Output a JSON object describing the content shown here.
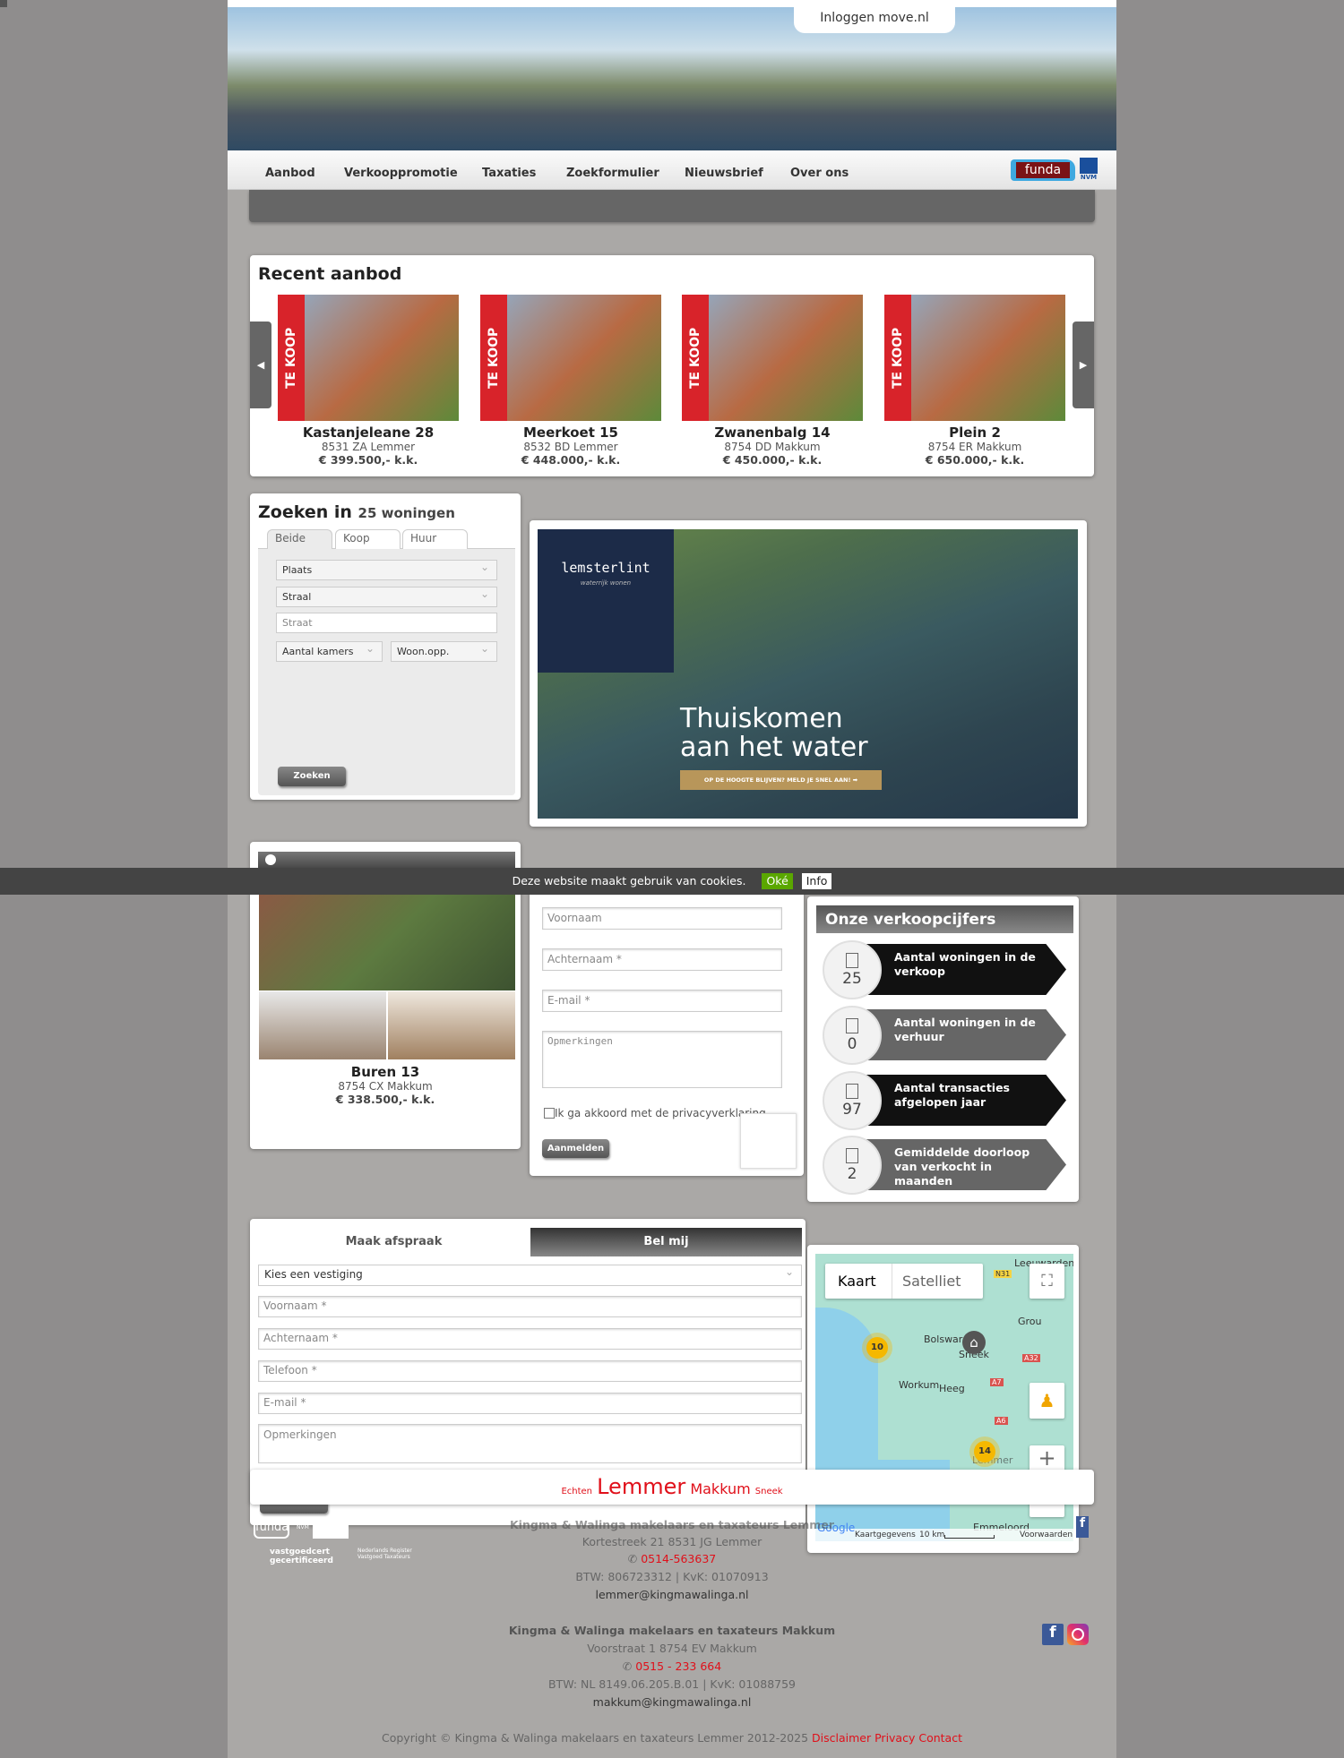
{
  "header": {
    "login_label": "Inloggen move.nl"
  },
  "nav": {
    "items": [
      "Aanbod",
      "Verkooppromotie",
      "Taxaties",
      "Zoekformulier",
      "Nieuwsbrief",
      "Over ons"
    ],
    "funda_logo": "funda",
    "nvm_logo": "NVM"
  },
  "recent": {
    "title": "Recent aanbod",
    "badge": "TE KOOP",
    "prev_icon": "chevron-left-icon",
    "next_icon": "chevron-right-icon",
    "items": [
      {
        "title": "Kastanjeleane 28",
        "address": "8531 ZA Lemmer",
        "price": "€ 399.500,- k.k."
      },
      {
        "title": "Meerkoet 15",
        "address": "8532 BD Lemmer",
        "price": "€ 448.000,- k.k."
      },
      {
        "title": "Zwanenbalg 14",
        "address": "8754 DD Makkum",
        "price": "€ 450.000,- k.k."
      },
      {
        "title": "Plein 2",
        "address": "8754 ER Makkum",
        "price": "€ 650.000,- k.k."
      }
    ]
  },
  "search": {
    "title": "Zoeken in",
    "count": "25 woningen",
    "tabs": [
      "Beide",
      "Koop",
      "Huur"
    ],
    "active_tab": "Beide",
    "plaats": "Plaats",
    "straal": "Straal",
    "straat_placeholder": "Straat",
    "kamers": "Aantal kamers",
    "woonopp": "Woon.opp.",
    "submit": "Zoeken"
  },
  "banner": {
    "brand": "lemsterlint",
    "tagline": "waterrijk wonen",
    "headline1": "Thuiskomen",
    "headline2": "aan het water",
    "cta": "OP DE HOOGTE BLIJVEN? MELD JE SNEL AAN!"
  },
  "featured": {
    "title": "Buren 13",
    "address": "8754 CX Makkum",
    "price": "€ 338.500,- k.k."
  },
  "cookie": {
    "text": "Deze website maakt gebruik van cookies.",
    "ok": "Oké",
    "info": "Info"
  },
  "newsletter": {
    "voornaam": "Voornaam",
    "achternaam": "Achternaam *",
    "email": "E-mail *",
    "opmerkingen": "Opmerkingen",
    "privacy": "Ik ga akkoord met de privacyverklaring",
    "submit": "Aanmelden"
  },
  "stats": {
    "title": "Onze verkoopcijfers",
    "items": [
      {
        "value": "25",
        "label": "Aantal woningen in de verkoop"
      },
      {
        "value": "0",
        "label": "Aantal woningen in de verhuur"
      },
      {
        "value": "97",
        "label": "Aantal transacties afgelopen jaar"
      },
      {
        "value": "2",
        "label": "Gemiddelde doorloop van verkocht in maanden"
      }
    ]
  },
  "appointment": {
    "tabs": [
      "Maak afspraak",
      "Bel mij"
    ],
    "vestiging": "Kies een vestiging",
    "voornaam": "Voornaam *",
    "achternaam": "Achternaam *",
    "telefoon": "Telefoon *",
    "email": "E-mail *",
    "opmerkingen": "Opmerkingen"
  },
  "map": {
    "type_map": "Kaart",
    "type_sat": "Satelliet",
    "clusters": [
      "10",
      "14"
    ],
    "labels": [
      "Leeuwarden",
      "Bolsward",
      "Sneek",
      "Grou",
      "Workum",
      "Heeg",
      "Emmeloord",
      "Lemmer"
    ],
    "roads": [
      "N31",
      "A32",
      "A7",
      "A6"
    ],
    "attribution": "Kaartgegevens",
    "scale": "10 km",
    "terms": "Voorwaarden",
    "google": "Google"
  },
  "cities": {
    "items": [
      "Echten",
      "Lemmer",
      "Makkum",
      "Sneek"
    ],
    "color": "#e0101a"
  },
  "footer": {
    "lemmer": {
      "name": "Kingma & Walinga makelaars en taxateurs Lemmer",
      "street": "Kortestreek 21   8531 JG Lemmer",
      "phone": "0514-563637",
      "btw": "BTW: 806723312 | KvK: 01070913",
      "email": "lemmer@kingmawalinga.nl"
    },
    "makkum": {
      "name": "Kingma & Walinga makelaars en taxateurs Makkum",
      "street": "Voorstraat 1   8754 EV Makkum",
      "phone": "0515 - 233 664",
      "btw": "BTW: NL 8149.06.205.B.01 | KvK: 01088759",
      "email": "makkum@kingmawalinga.nl"
    },
    "copyright": "Copyright © Kingma & Walinga makelaars en taxateurs Lemmer 2012-2025",
    "links": [
      "Disclaimer",
      "Privacy",
      "Contact"
    ],
    "logos": [
      "funda",
      "NVM",
      "vastgoedcert gecertificeerd",
      "Nederlands Register Vastgoed Taxateurs"
    ]
  }
}
